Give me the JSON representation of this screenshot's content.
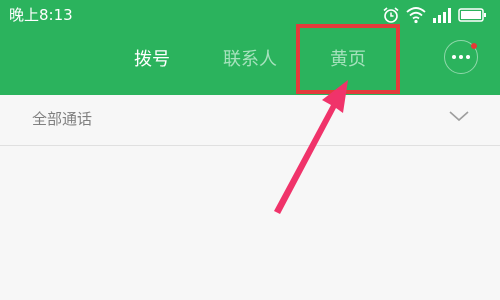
{
  "status_bar": {
    "time": "晚上8:13",
    "icons": [
      "alarm-icon",
      "wifi-icon",
      "signal-icon",
      "battery-icon"
    ]
  },
  "tabs": [
    {
      "label": "拨号",
      "active": true
    },
    {
      "label": "联系人",
      "active": false
    },
    {
      "label": "黄页",
      "active": false
    }
  ],
  "more_button": {
    "icon": "more-icon",
    "has_badge": true
  },
  "filter": {
    "label": "全部通话",
    "icon": "chevron-down-icon"
  },
  "colors": {
    "header_bg": "#2bb35d",
    "active_tab_text": "#ffffff",
    "inactive_tab_text": "#a6e2bd",
    "annotation": "#e33b3b",
    "arrow": "#f0336a",
    "badge": "#e53935"
  }
}
